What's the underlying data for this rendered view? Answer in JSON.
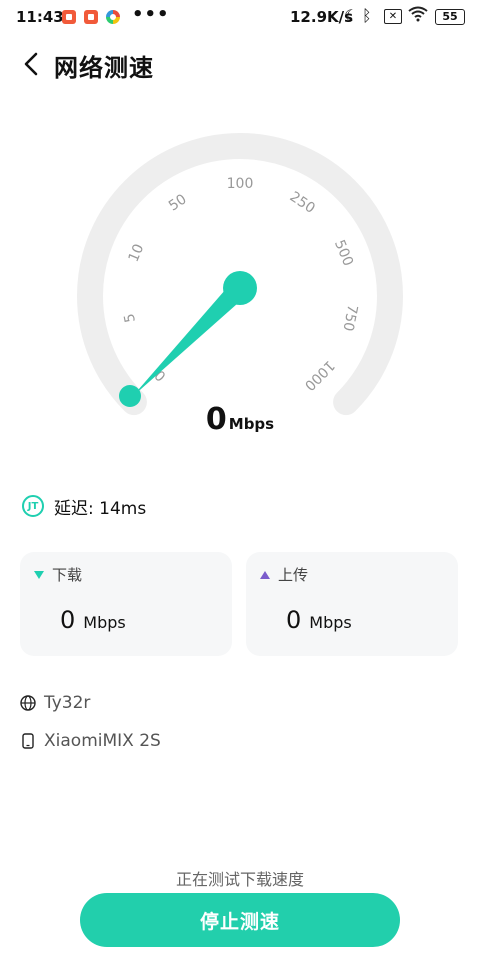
{
  "status_bar": {
    "time": "11:43",
    "dots": "•••",
    "net_speed": "12.9K/s",
    "battery": "55"
  },
  "header": {
    "title": "网络测速"
  },
  "gauge": {
    "tick_labels": [
      "0",
      "5",
      "10",
      "50",
      "100",
      "250",
      "500",
      "750",
      "1000"
    ],
    "value_mbps": 0,
    "track_color": "#eeeeee",
    "needle_color": "#1fcfb0",
    "display_value": "0",
    "display_unit": "Mbps"
  },
  "latency": {
    "label": "延迟: 14ms"
  },
  "download": {
    "label": "下载",
    "value": "0",
    "unit": "Mbps"
  },
  "upload": {
    "label": "上传",
    "value": "0",
    "unit": "Mbps"
  },
  "network": {
    "ssid": "Ty32r",
    "device": "XiaomiMIX 2S"
  },
  "footer": {
    "status": "正在测试下载速度",
    "stop_button": "停止测速"
  },
  "accent_color": "#22cfac"
}
